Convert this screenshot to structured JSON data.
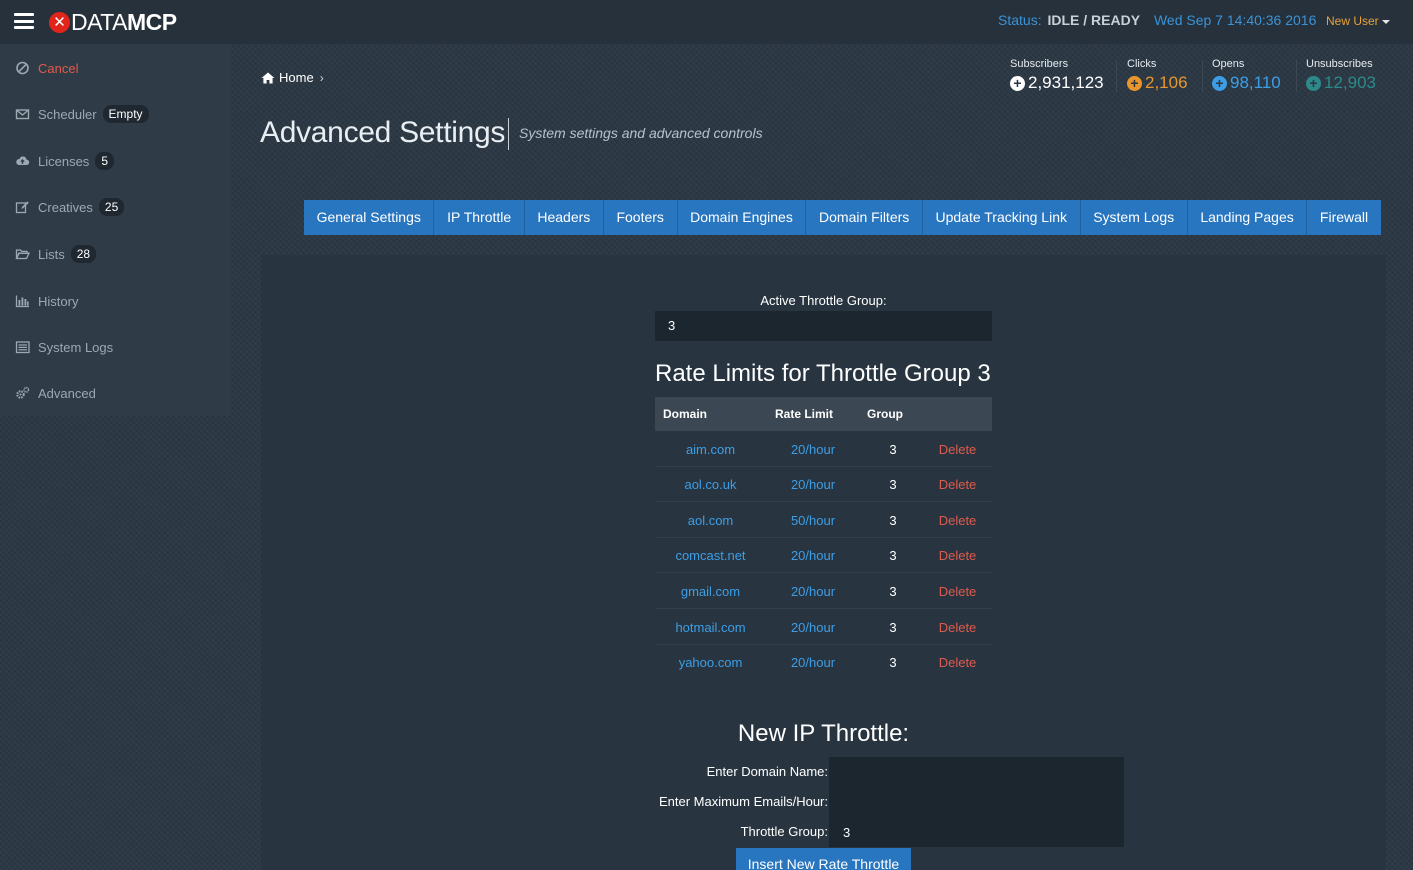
{
  "header": {
    "brand_data": "DATA",
    "brand_mcp": "MCP",
    "status_label": "Status:",
    "status_value": "IDLE / READY",
    "datetime": "Wed Sep 7 14:40:36 2016",
    "user": "New User"
  },
  "sidebar": {
    "items": [
      {
        "label": "Cancel",
        "icon": "ban-icon"
      },
      {
        "label": "Scheduler",
        "badge": "Empty",
        "icon": "envelope-icon"
      },
      {
        "label": "Licenses",
        "badge": "5",
        "icon": "cloud-upload-icon"
      },
      {
        "label": "Creatives",
        "badge": "25",
        "icon": "edit-icon"
      },
      {
        "label": "Lists",
        "badge": "28",
        "icon": "folder-open-icon"
      },
      {
        "label": "History",
        "icon": "bar-chart-icon"
      },
      {
        "label": "System Logs",
        "icon": "list-icon"
      },
      {
        "label": "Advanced",
        "icon": "gears-icon"
      }
    ]
  },
  "breadcrumb": {
    "home": "Home"
  },
  "page": {
    "title": "Advanced Settings",
    "subtitle": "System settings and advanced controls"
  },
  "stats": [
    {
      "label": "Subscribers",
      "value": "2,931,123",
      "color": "#ffffff"
    },
    {
      "label": "Clicks",
      "value": "2,106",
      "color": "#e8962c"
    },
    {
      "label": "Opens",
      "value": "98,110",
      "color": "#3d9ee6"
    },
    {
      "label": "Unsubscribes",
      "value": "12,903",
      "color": "#2c8a8a"
    }
  ],
  "tabs": [
    "General Settings",
    "IP Throttle",
    "Headers",
    "Footers",
    "Domain Engines",
    "Domain Filters",
    "Update Tracking Link",
    "System Logs",
    "Landing Pages",
    "Firewall"
  ],
  "throttle": {
    "active_label": "Active Throttle Group:",
    "active_value": "3",
    "table_title": "Rate Limits for Throttle Group 3",
    "columns": [
      "Domain",
      "Rate Limit",
      "Group"
    ],
    "rows": [
      {
        "domain": "aim.com",
        "rate": "20/hour",
        "group": "3",
        "action": "Delete"
      },
      {
        "domain": "aol.co.uk",
        "rate": "20/hour",
        "group": "3",
        "action": "Delete"
      },
      {
        "domain": "aol.com",
        "rate": "50/hour",
        "group": "3",
        "action": "Delete"
      },
      {
        "domain": "comcast.net",
        "rate": "20/hour",
        "group": "3",
        "action": "Delete"
      },
      {
        "domain": "gmail.com",
        "rate": "20/hour",
        "group": "3",
        "action": "Delete"
      },
      {
        "domain": "hotmail.com",
        "rate": "20/hour",
        "group": "3",
        "action": "Delete"
      },
      {
        "domain": "yahoo.com",
        "rate": "20/hour",
        "group": "3",
        "action": "Delete"
      }
    ]
  },
  "new_throttle": {
    "title": "New IP Throttle:",
    "domain_label": "Enter Domain Name:",
    "domain_value": "",
    "max_label": "Enter Maximum Emails/Hour:",
    "max_value": "",
    "group_label": "Throttle Group:",
    "group_value": "3",
    "submit": "Insert New Rate Throttle"
  }
}
